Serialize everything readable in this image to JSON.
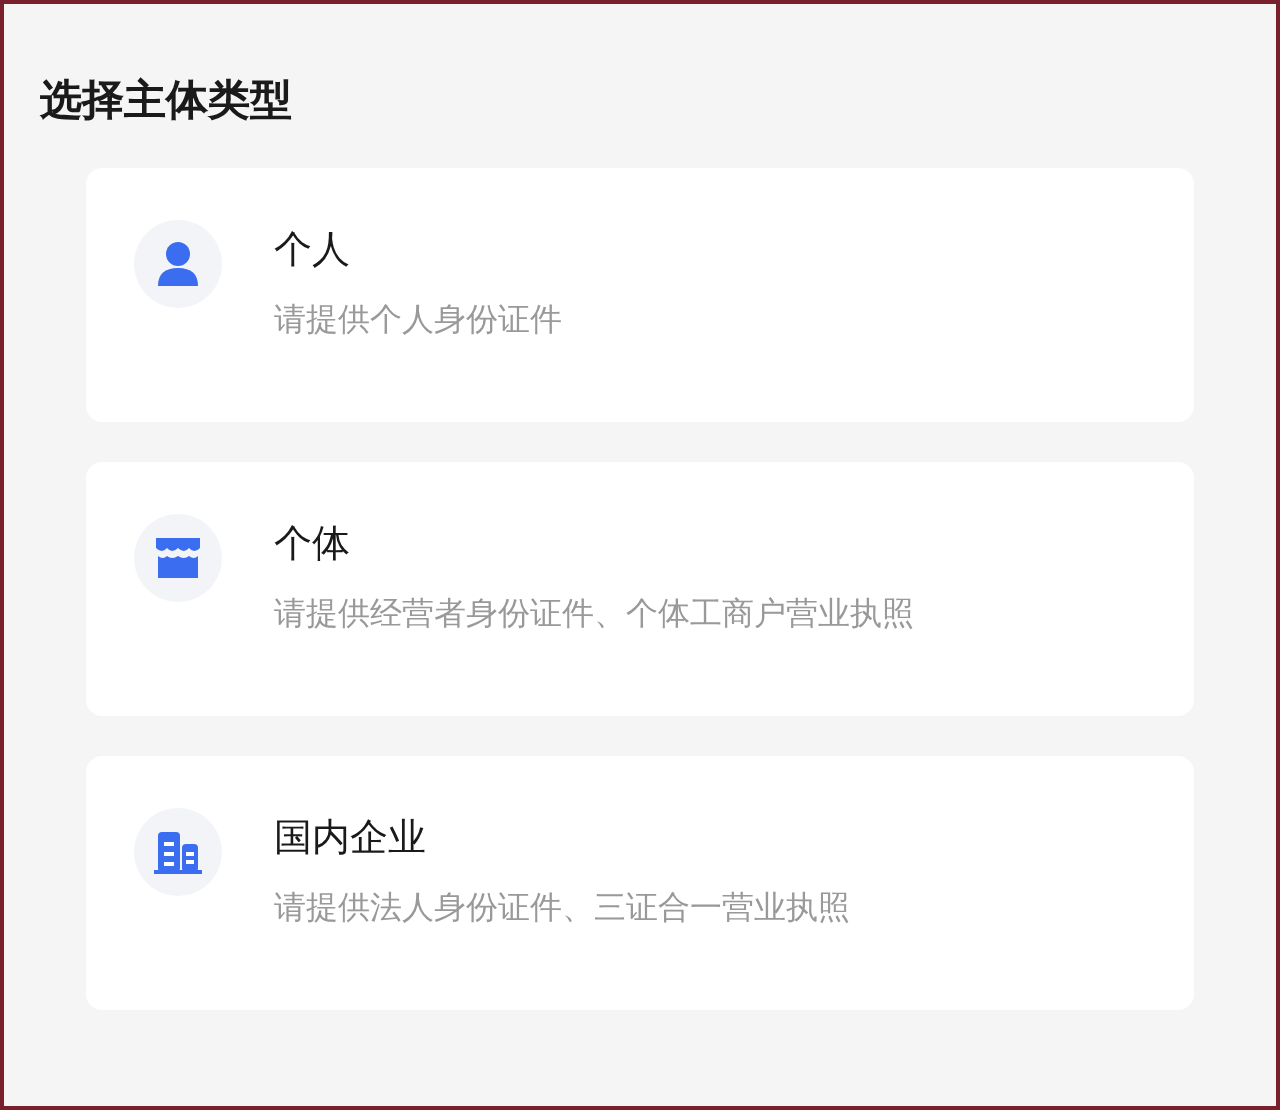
{
  "title": "选择主体类型",
  "options": [
    {
      "kind": "person",
      "name": "个人",
      "description": "请提供个人身份证件"
    },
    {
      "kind": "shop",
      "name": "个体",
      "description": "请提供经营者身份证件、个体工商户营业执照"
    },
    {
      "kind": "building",
      "name": "国内企业",
      "description": "请提供法人身份证件、三证合一营业执照"
    }
  ]
}
